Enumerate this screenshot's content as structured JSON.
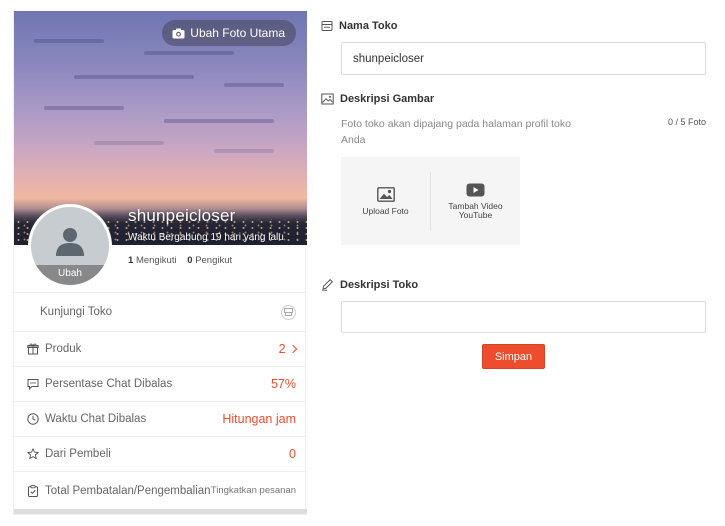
{
  "cover": {
    "change_photo_label": "Ubah Foto Utama"
  },
  "profile": {
    "shop_name": "shunpeicloser",
    "joined": "Waktu Bergabung 19 hari yang lalu",
    "avatar_edit_label": "Ubah",
    "following_count": "1",
    "following_label": "Mengikuti",
    "followers_count": "0",
    "followers_label": "Pengikut"
  },
  "stats": {
    "visit_label": "Kunjungi Toko",
    "products_label": "Produk",
    "products_value": "2",
    "chat_rate_label": "Persentase Chat Dibalas",
    "chat_rate_value": "57%",
    "chat_time_label": "Waktu Chat Dibalas",
    "chat_time_value": "Hitungan jam",
    "ratings_label": "Dari Pembeli",
    "ratings_value": "0",
    "cancellation_label": "Total Pembatalan/Pengembalian",
    "cancellation_hint": "Tingkatkan pesanan"
  },
  "form": {
    "shop_name_label": "Nama Toko",
    "shop_name_value": "shunpeicloser",
    "image_desc_label": "Deskripsi Gambar",
    "image_desc_text": "Foto toko akan dipajang pada halaman profil toko Anda",
    "image_counter": "0 / 5 Foto",
    "upload_photo_label": "Upload Foto",
    "add_video_label": "Tambah Video YouTube",
    "shop_desc_label": "Deskripsi Toko",
    "shop_desc_value": "",
    "save_label": "Simpan"
  },
  "colors": {
    "accent": "#ee4d2d"
  },
  "icons": {
    "camera": "camera-icon",
    "avatar": "user-silhouette-icon",
    "visit": "storefront-icon",
    "products": "gift-box-icon",
    "chat_rate": "chat-bubble-icon",
    "chat_time": "clock-icon",
    "ratings": "star-icon",
    "cancellation": "clipboard-icon",
    "shop_name_field": "card-icon",
    "image_desc": "image-icon",
    "upload_photo": "photo-icon",
    "add_video": "youtube-play-icon",
    "shop_desc": "pencil-icon"
  }
}
